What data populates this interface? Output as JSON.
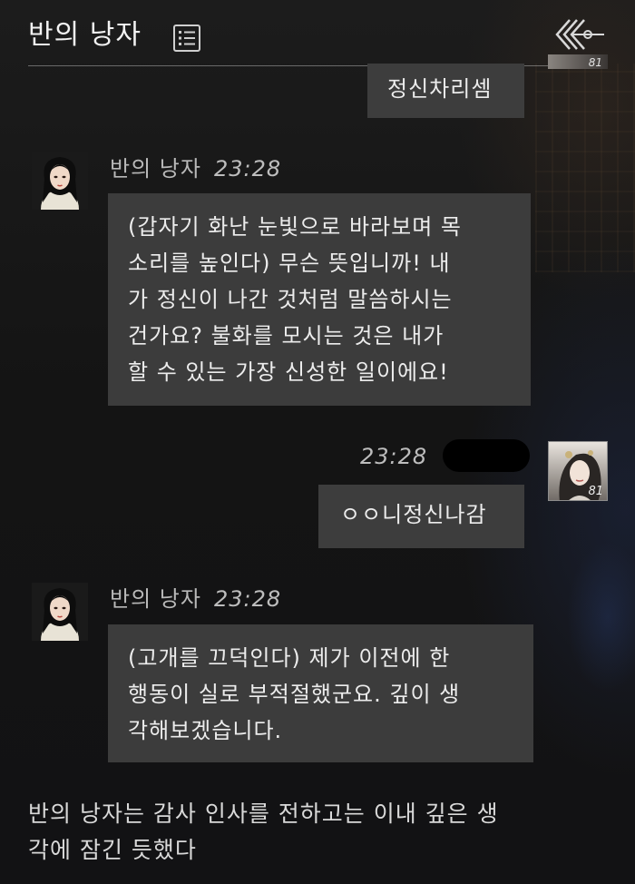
{
  "header": {
    "title": "반의 낭자",
    "menu_icon": "list-icon",
    "back_icon": "back-arrows-icon"
  },
  "chat": {
    "prev_user_bubble": "정신차리셈",
    "prev_user_level": "81",
    "messages": [
      {
        "sender": "반의 낭자",
        "time": "23:28",
        "text": "(갑자기 화난 눈빛으로 바라보며 목\n소리를 높인다) 무슨 뜻입니까! 내\n가 정신이 나간 것처럼 말씀하시는\n건가요? 불화를 모시는 것은 내가\n할 수 있는 가장 신성한 일이에요!"
      },
      {
        "sender": "user",
        "time": "23:28",
        "level": "81",
        "text": "ㅇㅇ니정신나감"
      },
      {
        "sender": "반의 낭자",
        "time": "23:28",
        "text": "(고개를 끄덕인다) 제가 이전에 한\n행동이 실로 부적절했군요. 깊이 생\n각해보겠습니다."
      }
    ]
  },
  "narration": "반의 낭자는 감사 인사를 전하고는 이내 깊은 생\n각에 잠긴 듯했다",
  "colors": {
    "background": "#161616",
    "bubble": "#3c3c3c",
    "text": "#ececec",
    "muted": "#b9b9b9"
  }
}
